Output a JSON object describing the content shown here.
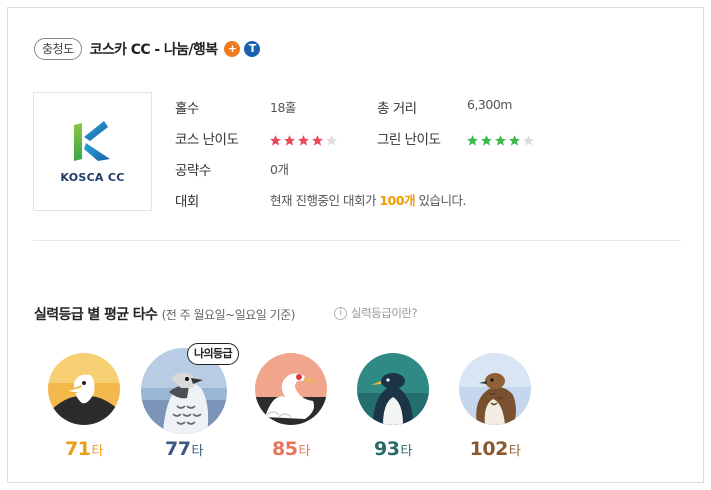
{
  "course": {
    "region": "충청도",
    "name": "코스카 CC - 나눔/행복",
    "logo_text": "KOSCA CC",
    "badges": [
      {
        "icon": "plus-badge-icon",
        "symbol": "+",
        "color": "#f07a1c"
      },
      {
        "icon": "t-badge-icon",
        "symbol": "T",
        "color": "#1a5fb0"
      }
    ]
  },
  "info": {
    "holes_label": "홀수",
    "holes_value": "18홀",
    "distance_label": "총 거리",
    "distance_value": "6,300m",
    "course_difficulty_label": "코스 난이도",
    "course_difficulty": 4,
    "course_difficulty_max": 5,
    "course_star_color": "#e8485a",
    "green_difficulty_label": "그린 난이도",
    "green_difficulty": 4,
    "green_difficulty_max": 5,
    "green_star_color": "#3cb94a",
    "strategy_label": "공략수",
    "strategy_value": "0개",
    "tournament_label": "대회",
    "tournament_prefix": "현재 진행중인 대회가 ",
    "tournament_count": "100개",
    "tournament_suffix": " 있습니다."
  },
  "skill": {
    "title": "실력등급 별 평균 타수",
    "subtitle": "(전 주 월요일~일요일 기준)",
    "help_label": "실력등급이란?",
    "my_grade_label": "나의등급",
    "unit": "타",
    "grades": [
      {
        "score": "71",
        "color": "#ef9a14",
        "bird": "eagle-icon"
      },
      {
        "score": "77",
        "color": "#3d5a80",
        "bird": "hawk-icon"
      },
      {
        "score": "85",
        "color": "#e8735a",
        "bird": "crane-icon"
      },
      {
        "score": "93",
        "color": "#2a6a6a",
        "bird": "penguin-icon"
      },
      {
        "score": "102",
        "color": "#8a5a32",
        "bird": "sparrow-icon"
      }
    ]
  }
}
